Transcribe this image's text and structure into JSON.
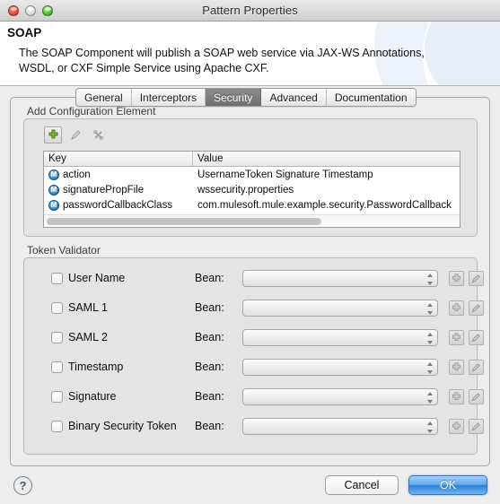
{
  "window": {
    "title": "Pattern Properties",
    "traffic_lights": [
      "close-button",
      "minimize-button",
      "zoom-button"
    ]
  },
  "header": {
    "title": "SOAP",
    "description": "The SOAP Component will publish a SOAP web service via JAX-WS Annotations, WSDL, or CXF Simple Service using Apache CXF."
  },
  "tabs": [
    {
      "label": "General",
      "active": false
    },
    {
      "label": "Interceptors",
      "active": false
    },
    {
      "label": "Security",
      "active": true
    },
    {
      "label": "Advanced",
      "active": false
    },
    {
      "label": "Documentation",
      "active": false
    }
  ],
  "config_group": {
    "label": "Add Configuration Element",
    "toolbar": {
      "add_label": "+",
      "edit_label": "✎",
      "delete_label": "✖"
    },
    "columns": [
      "Key",
      "Value"
    ],
    "rows": [
      {
        "icon": "mule-icon",
        "key": "action",
        "value": "UsernameToken Signature Timestamp"
      },
      {
        "icon": "mule-icon",
        "key": "signaturePropFile",
        "value": "wssecurity.properties"
      },
      {
        "icon": "mule-icon",
        "key": "passwordCallbackClass",
        "value": "com.mulesoft.mule.example.security.PasswordCallback"
      }
    ],
    "scroll_thumb_pct": 66
  },
  "token_validator": {
    "label": "Token Validator",
    "bean_label": "Bean:",
    "rows": [
      {
        "label": "User Name",
        "checked": false,
        "bean_value": ""
      },
      {
        "label": "SAML 1",
        "checked": false,
        "bean_value": ""
      },
      {
        "label": "SAML 2",
        "checked": false,
        "bean_value": ""
      },
      {
        "label": "Timestamp",
        "checked": false,
        "bean_value": ""
      },
      {
        "label": "Signature",
        "checked": false,
        "bean_value": ""
      },
      {
        "label": "Binary Security Token",
        "checked": false,
        "bean_value": ""
      }
    ]
  },
  "footer": {
    "help_label": "?",
    "cancel_label": "Cancel",
    "ok_label": "OK"
  },
  "colors": {
    "accent": "#2f7fd8",
    "window_bg": "#ededed",
    "panel_bg": "#e4e4e4",
    "tab_active_bg": "#7d7d7d"
  }
}
